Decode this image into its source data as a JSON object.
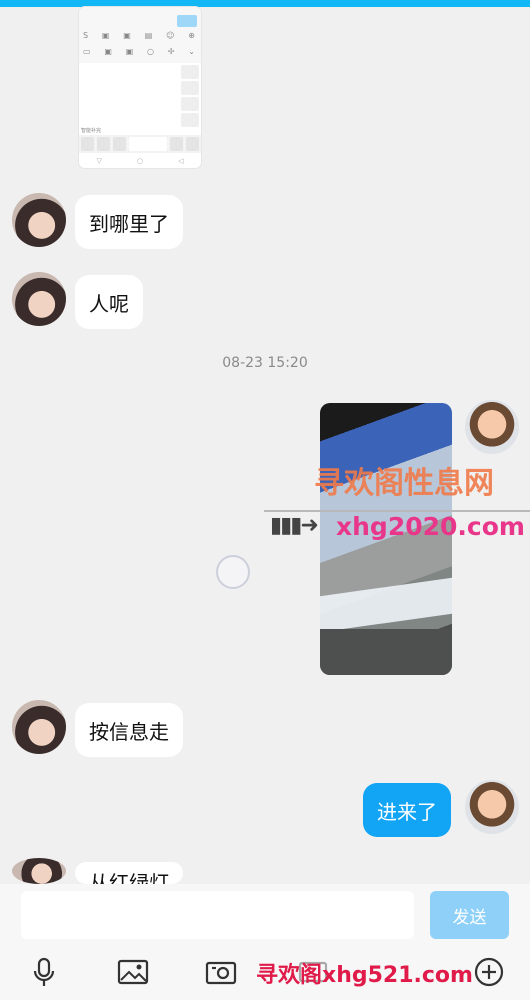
{
  "messages": [
    {
      "side": "left",
      "text": "到哪里了"
    },
    {
      "side": "left",
      "text": "人呢"
    },
    {
      "side": "left",
      "text": "按信息走"
    },
    {
      "side": "right",
      "text": "进来了"
    },
    {
      "side": "left",
      "text": "从红绿灯"
    }
  ],
  "timestamp": "08-23 15:20",
  "keyboard_thumb": {
    "row1": [
      "S",
      "▣",
      "▣",
      "▤",
      "☺",
      "⊕"
    ],
    "row2": [
      "▭",
      "▣",
      "▣",
      "○",
      "✢",
      "⌄"
    ],
    "bottom_text": "智能补完",
    "nav": [
      "▽",
      "○",
      "◁"
    ]
  },
  "watermark": {
    "line1": "寻欢阁性息网",
    "line2": "xhg2020.com",
    "line3": "寻欢阁xhg521.com",
    "arrow": "▮▮▮➜"
  },
  "composer": {
    "input_value": "",
    "send_label": "发送"
  },
  "toolbar": {
    "icons": [
      "microphone-icon",
      "image-icon",
      "camera-icon",
      "keyboard-icon",
      "plus-icon"
    ]
  },
  "colors": {
    "accent": "#12a4f5",
    "send_disabled": "#8ed0f8",
    "background": "#f0f0f0"
  }
}
